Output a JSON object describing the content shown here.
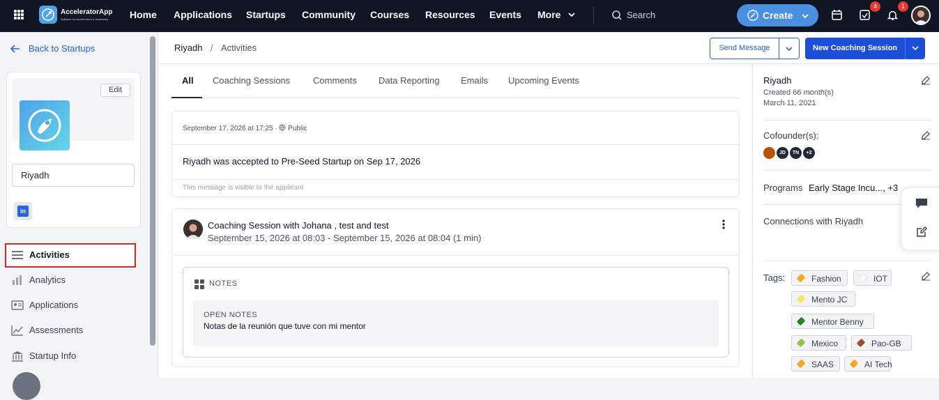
{
  "topnav": {
    "brand": "AcceleratorApp",
    "brand_sub": "Software for Accelerators & Incubators",
    "items": [
      "Home",
      "Applications",
      "Startups",
      "Community",
      "Courses",
      "Resources",
      "Events",
      "More"
    ],
    "search_placeholder": "Search",
    "create_label": "Create",
    "tasks_badge": "4",
    "notifications_badge": "1"
  },
  "sidebar": {
    "back_label": "Back to Startups",
    "edit_label": "Edit",
    "startup_name": "Riyadh",
    "linkedin_label": "in",
    "menu": [
      {
        "label": "Activities",
        "icon": "menu-lines-icon"
      },
      {
        "label": "Analytics",
        "icon": "bar-chart-icon"
      },
      {
        "label": "Applications",
        "icon": "id-card-icon"
      },
      {
        "label": "Assessments",
        "icon": "line-chart-icon"
      },
      {
        "label": "Startup Info",
        "icon": "bank-icon"
      }
    ]
  },
  "subheader": {
    "breadcrumb_root": "Riyadh",
    "breadcrumb_sep": "/",
    "breadcrumb_current": "Activities",
    "send_message": "Send Message",
    "new_coaching": "New Coaching Session"
  },
  "main": {
    "tabs": [
      "All",
      "Coaching Sessions",
      "Comments",
      "Data Reporting",
      "Emails",
      "Upcoming Events"
    ],
    "card1": {
      "meta_date": "September 17, 2026 at 17:25",
      "meta_visibility": "Public",
      "message": "Riyadh was accepted to Pre-Seed Startup on Sep 17, 2026",
      "note": "This message is visible to the applicant"
    },
    "card2": {
      "title": "Coaching Session with Johana , test and test",
      "time": "September 15, 2026 at 08:03 - September 15, 2026 at 08:04 (1 min)",
      "notes_header": "NOTES",
      "open_notes_label": "OPEN NOTES",
      "open_notes_body": "Notas de la reunión que tuve con mi mentor"
    }
  },
  "right": {
    "name": "Riyadh",
    "created": "Created 66 month(s)",
    "date": "March 11, 2021",
    "cofounders_label": "Cofounder(s):",
    "cofounders": [
      "JD",
      "TN",
      "+2"
    ],
    "programs_label": "Programs",
    "programs_value": "Early Stage Incu..., +3",
    "connections_label": "Connections with Riyadh",
    "tags_label": "Tags:",
    "tags": [
      {
        "label": "Fashion",
        "color": "#f5a623"
      },
      {
        "label": "IOT",
        "color": "#ffffff"
      },
      {
        "label": "Mento JC",
        "color": "#f5e663"
      },
      {
        "label": "Mentor Benny",
        "color": "#2e7d32"
      },
      {
        "label": "Mexico",
        "color": "#8bc34a"
      },
      {
        "label": "Pao-GB",
        "color": "#a0522d"
      },
      {
        "label": "SAAS",
        "color": "#f5a623"
      },
      {
        "label": "AI Tech",
        "color": "#f5a623"
      }
    ]
  }
}
